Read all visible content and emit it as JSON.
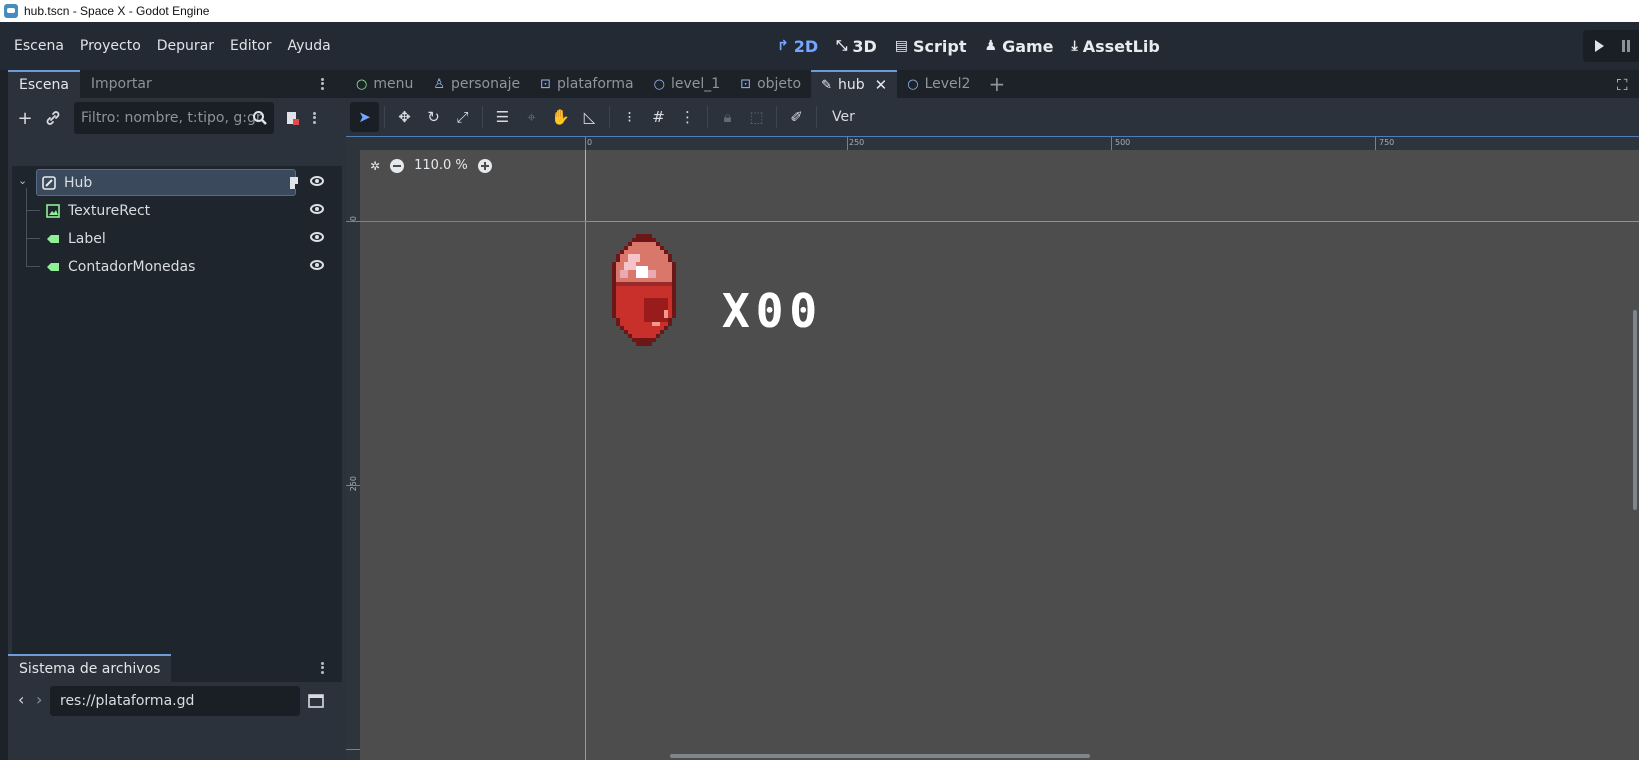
{
  "window": {
    "title": "hub.tscn - Space X - Godot Engine"
  },
  "menu": [
    "Escena",
    "Proyecto",
    "Depurar",
    "Editor",
    "Ayuda"
  ],
  "main_screens": [
    {
      "label": "2D",
      "icon": "2d-icon",
      "active": true
    },
    {
      "label": "3D",
      "icon": "3d-icon",
      "active": false
    },
    {
      "label": "Script",
      "icon": "script-icon",
      "active": false
    },
    {
      "label": "Game",
      "icon": "game-icon",
      "active": false
    },
    {
      "label": "AssetLib",
      "icon": "assetlib-icon",
      "active": false
    }
  ],
  "scene_dock": {
    "tabs": [
      "Escena",
      "Importar"
    ],
    "filter_placeholder": "Filtro: nombre, t:tipo, g:gr",
    "tree": [
      {
        "label": "Hub",
        "icon": "control-icon",
        "selected": true
      },
      {
        "label": "TextureRect",
        "icon": "texturerect-icon",
        "selected": false
      },
      {
        "label": "Label",
        "icon": "label-icon",
        "selected": false
      },
      {
        "label": "ContadorMonedas",
        "icon": "label-icon",
        "selected": false
      }
    ]
  },
  "filesystem_dock": {
    "tab": "Sistema de archivos",
    "path": "res://plataforma.gd"
  },
  "scene_tabs": [
    {
      "label": "menu",
      "icon": "node-circle-icon"
    },
    {
      "label": "personaje",
      "icon": "character-icon"
    },
    {
      "label": "plataforma",
      "icon": "area-icon"
    },
    {
      "label": "level_1",
      "icon": "node-circle-icon"
    },
    {
      "label": "objeto",
      "icon": "area-icon"
    },
    {
      "label": "hub",
      "icon": "control-icon",
      "active": true
    },
    {
      "label": "Level2",
      "icon": "node-circle-icon"
    }
  ],
  "viewport": {
    "view_menu": "Ver",
    "zoom": "110.0 %",
    "ruler_top": [
      "0",
      "250",
      "500",
      "750"
    ],
    "ruler_left": [
      "0",
      "250"
    ],
    "hud_text": "X00"
  },
  "colors": {
    "accent": "#74a7ff",
    "canvas": "#4d4d4d",
    "panel": "#2b323c",
    "gem_red": "#c9302c"
  }
}
